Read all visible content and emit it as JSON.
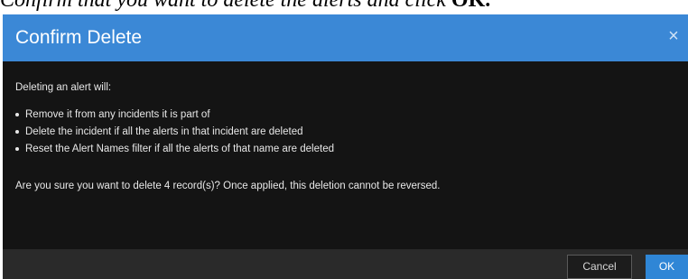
{
  "caption": {
    "text": "Confirm that you want to delete the alerts and click ",
    "emphasis": "OK."
  },
  "dialog": {
    "title": "Confirm Delete",
    "close_glyph": "×",
    "intro": "Deleting an alert will:",
    "bullets": [
      "Remove it from any incidents it is part of",
      "Delete the incident if all the alerts in that incident are deleted",
      "Reset the Alert Names filter if all the alerts of that name are deleted"
    ],
    "question": "Are you sure you want to delete 4 record(s)? Once applied, this deletion cannot be reversed.",
    "buttons": {
      "cancel": "Cancel",
      "ok": "OK"
    }
  },
  "icons": {
    "close": "close-icon"
  },
  "colors": {
    "header": "#3b88d6",
    "body": "#141414",
    "footer": "#2a2a2a",
    "ok_button": "#2f86d6"
  }
}
